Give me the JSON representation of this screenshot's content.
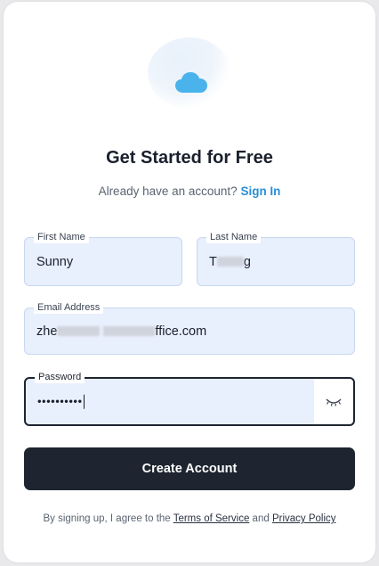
{
  "header": {
    "title": "Get Started for Free",
    "subtitle_prefix": "Already have an account?",
    "sign_in_label": "Sign In",
    "logo_icon": "cloud-icon"
  },
  "form": {
    "first_name": {
      "label": "First Name",
      "value": "Sunny"
    },
    "last_name": {
      "label": "Last Name",
      "value_visible": "T",
      "value_suffix": "g"
    },
    "email": {
      "label": "Email Address",
      "value_prefix": "zhe",
      "value_suffix": "ffice.com"
    },
    "password": {
      "label": "Password",
      "value": "••••••••••",
      "toggle_icon": "eye-closed-icon"
    }
  },
  "actions": {
    "create_account_label": "Create Account"
  },
  "footer": {
    "terms_prefix": "By signing up, I agree to the",
    "terms_link": "Terms of Service",
    "and": "and",
    "privacy_link": "Privacy Policy"
  },
  "colors": {
    "accent": "#2b8fd6",
    "button_bg": "#1e2530",
    "field_bg": "#e8effd"
  }
}
